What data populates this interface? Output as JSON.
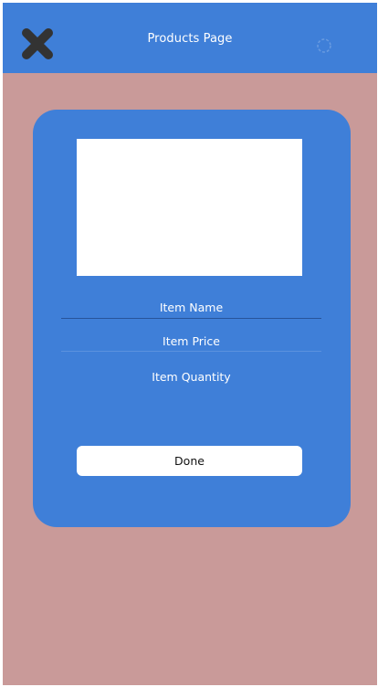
{
  "header": {
    "title": "Products Page",
    "close_icon": "close-x-icon",
    "right_icon": "loading-spinner-icon"
  },
  "form": {
    "image_placeholder_icon": "image-placeholder",
    "item_name_placeholder": "Item Name",
    "item_price_placeholder": "Item Price",
    "item_quantity_placeholder": "Item Quantity",
    "done_label": "Done"
  },
  "colors": {
    "header_background": "#3f7fd8",
    "page_background": "#c99a99",
    "card_background": "#3f7fd8",
    "close_icon": "#333333",
    "button_background": "#ffffff"
  }
}
